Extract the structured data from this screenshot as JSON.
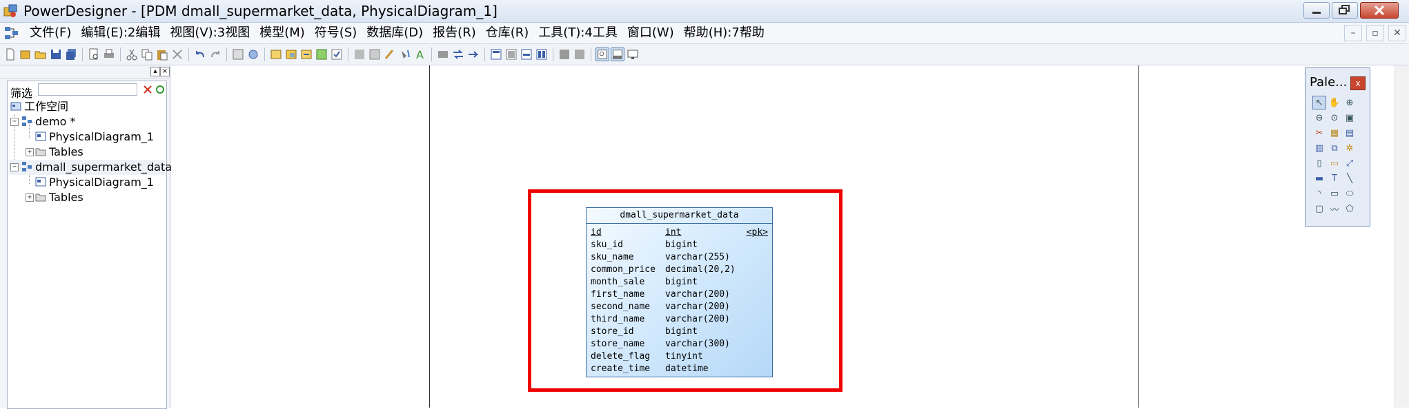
{
  "window": {
    "title": "PowerDesigner - [PDM dmall_supermarket_data, PhysicalDiagram_1]"
  },
  "menu": {
    "items": [
      "文件(F)",
      "编辑(E):2编辑",
      "视图(V):3视图",
      "模型(M)",
      "符号(S)",
      "数据库(D)",
      "报告(R)",
      "仓库(R)",
      "工具(T):4工具",
      "窗口(W)",
      "帮助(H):7帮助"
    ]
  },
  "browser": {
    "filter_label": "筛选",
    "filter_value": "",
    "tree": {
      "workspace": "工作空间",
      "demo": "demo *",
      "demo_diagram": "PhysicalDiagram_1",
      "demo_tables": "Tables",
      "dmall": "dmall_supermarket_data",
      "dmall_diagram": "PhysicalDiagram_1",
      "dmall_tables": "Tables"
    }
  },
  "entity": {
    "name": "dmall_supermarket_data",
    "columns": [
      {
        "name": "id",
        "type": "int",
        "key": "<pk>"
      },
      {
        "name": "sku_id",
        "type": "bigint",
        "key": ""
      },
      {
        "name": "sku_name",
        "type": "varchar(255)",
        "key": ""
      },
      {
        "name": "common_price",
        "type": "decimal(20,2)",
        "key": ""
      },
      {
        "name": "month_sale",
        "type": "bigint",
        "key": ""
      },
      {
        "name": "first_name",
        "type": "varchar(200)",
        "key": ""
      },
      {
        "name": "second_name",
        "type": "varchar(200)",
        "key": ""
      },
      {
        "name": "third_name",
        "type": "varchar(200)",
        "key": ""
      },
      {
        "name": "store_id",
        "type": "bigint",
        "key": ""
      },
      {
        "name": "store_name",
        "type": "varchar(300)",
        "key": ""
      },
      {
        "name": "delete_flag",
        "type": "tinyint",
        "key": ""
      },
      {
        "name": "create_time",
        "type": "datetime",
        "key": ""
      }
    ]
  },
  "palette": {
    "title": "Pale...",
    "close_label": "x",
    "tools": [
      "pointer-icon",
      "hand-icon",
      "zoom-in-icon",
      "zoom-out-icon",
      "zoom-icon",
      "properties-icon",
      "cut-icon",
      "package-icon",
      "table-icon",
      "view-icon",
      "reference-icon",
      "procedure-icon",
      "file-icon",
      "folder-icon",
      "link-icon",
      "note-icon",
      "text-icon",
      "line-icon",
      "arc-icon",
      "rectangle-icon",
      "ellipse-icon",
      "rounded-rect-icon",
      "polyline-icon",
      "polygon-icon"
    ]
  },
  "colors": {
    "highlight": "#ee0000",
    "entity_border": "#3b6ea5",
    "entity_fill": "#c6e2fb"
  }
}
